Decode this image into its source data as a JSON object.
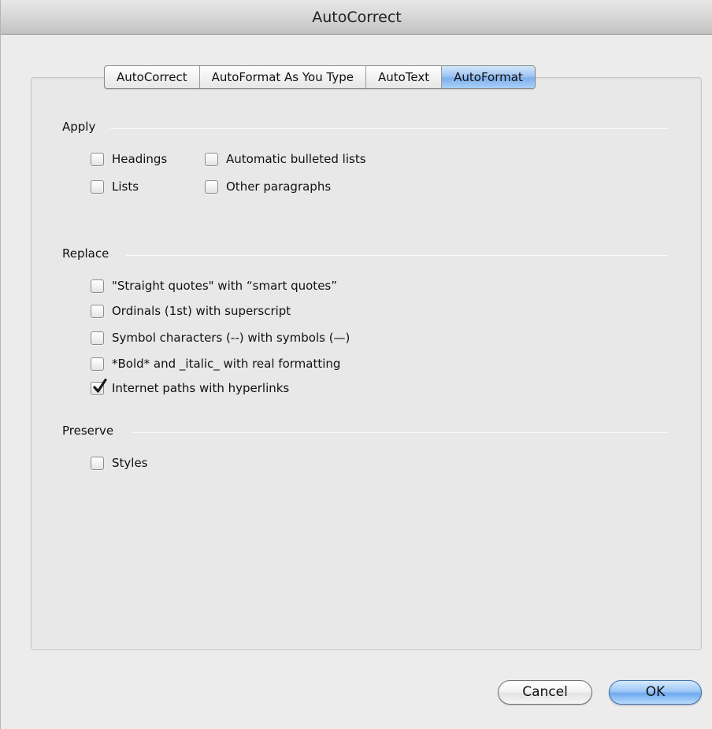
{
  "window": {
    "title": "AutoCorrect"
  },
  "tabs": [
    {
      "label": "AutoCorrect",
      "selected": false
    },
    {
      "label": "AutoFormat As You Type",
      "selected": false
    },
    {
      "label": "AutoText",
      "selected": false
    },
    {
      "label": "AutoFormat",
      "selected": true
    }
  ],
  "apply": {
    "label": "Apply",
    "options": [
      {
        "label": "Headings",
        "checked": false
      },
      {
        "label": "Automatic bulleted lists",
        "checked": false
      },
      {
        "label": "Lists",
        "checked": false
      },
      {
        "label": "Other paragraphs",
        "checked": false
      }
    ]
  },
  "replace": {
    "label": "Replace",
    "options": [
      {
        "label": "\"Straight quotes\" with “smart quotes”",
        "checked": false
      },
      {
        "label": "Ordinals (1st) with superscript",
        "checked": false
      },
      {
        "label": "Symbol characters (--) with symbols (—)",
        "checked": false
      },
      {
        "label": "*Bold* and _italic_ with real formatting",
        "checked": false
      },
      {
        "label": "Internet paths with hyperlinks",
        "checked": true
      }
    ]
  },
  "preserve": {
    "label": "Preserve",
    "options": [
      {
        "label": "Styles",
        "checked": false
      }
    ]
  },
  "buttons": {
    "cancel": "Cancel",
    "ok": "OK"
  },
  "colors": {
    "accent": "#7fb0ec",
    "window_bg": "#ececec",
    "check_mark": "#1a1a1a"
  }
}
